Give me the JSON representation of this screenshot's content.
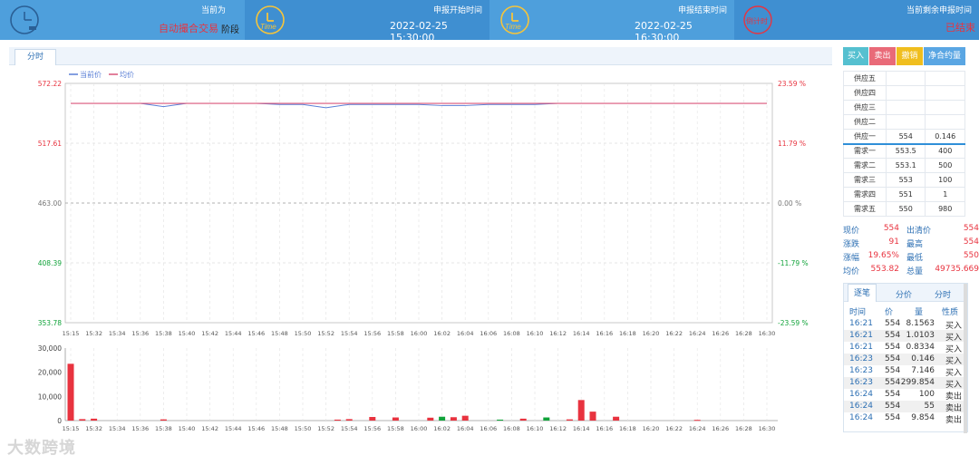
{
  "header": {
    "phase_label": "当前为",
    "phase_value": "自动撮合交易",
    "phase_suffix": "阶段",
    "start_label": "申报开始时间",
    "start_value": "2022-02-25 15:30:00",
    "end_label": "申报结束时间",
    "end_value": "2022-02-25 16:30:00",
    "countdown_icon_text": "倒计时",
    "remaining_label": "当前剩余申报时间",
    "remaining_value": "已结束",
    "time_icon_text": "Time"
  },
  "tabs": {
    "minute": "分时"
  },
  "buttons": {
    "buy": "买入",
    "sell": "卖出",
    "cancel": "撤销",
    "net": "净合约量"
  },
  "colors": {
    "buy": "#55c0d0",
    "sell": "#e96a78",
    "cancel": "#f0be1e",
    "net": "#5aa6e3",
    "up": "#e8333f",
    "down": "#11a33a",
    "header": "#4e9fdc"
  },
  "order_book": {
    "asks": [
      {
        "label": "供应五",
        "price": "",
        "qty": ""
      },
      {
        "label": "供应四",
        "price": "",
        "qty": ""
      },
      {
        "label": "供应三",
        "price": "",
        "qty": ""
      },
      {
        "label": "供应二",
        "price": "",
        "qty": ""
      },
      {
        "label": "供应一",
        "price": "554",
        "qty": "0.146"
      }
    ],
    "bids": [
      {
        "label": "需求一",
        "price": "553.5",
        "qty": "400"
      },
      {
        "label": "需求二",
        "price": "553.1",
        "qty": "500"
      },
      {
        "label": "需求三",
        "price": "553",
        "qty": "100"
      },
      {
        "label": "需求四",
        "price": "551",
        "qty": "1"
      },
      {
        "label": "需求五",
        "price": "550",
        "qty": "980"
      }
    ]
  },
  "quote": {
    "rows": [
      {
        "l1": "现价",
        "v1": "554",
        "l2": "出清价",
        "v2": "554"
      },
      {
        "l1": "涨跌",
        "v1": "91",
        "l2": "最高",
        "v2": "554"
      },
      {
        "l1": "涨幅",
        "v1": "19.65%",
        "l2": "最低",
        "v2": "550"
      },
      {
        "l1": "均价",
        "v1": "553.82",
        "l2": "总量",
        "v2": "49735.669"
      }
    ]
  },
  "ticks": {
    "tabs": [
      "逐笔",
      "分价",
      "分时"
    ],
    "headers": [
      "时间",
      "价",
      "量",
      "性质"
    ],
    "rows": [
      {
        "time": "16:21",
        "price": "554",
        "qty": "8.1563",
        "side": "买入"
      },
      {
        "time": "16:21",
        "price": "554",
        "qty": "1.0103",
        "side": "买入"
      },
      {
        "time": "16:21",
        "price": "554",
        "qty": "0.8334",
        "side": "买入"
      },
      {
        "time": "16:23",
        "price": "554",
        "qty": "0.146",
        "side": "买入"
      },
      {
        "time": "16:23",
        "price": "554",
        "qty": "7.146",
        "side": "买入"
      },
      {
        "time": "16:23",
        "price": "554",
        "qty": "299.854",
        "side": "买入"
      },
      {
        "time": "16:24",
        "price": "554",
        "qty": "100",
        "side": "卖出"
      },
      {
        "time": "16:24",
        "price": "554",
        "qty": "55",
        "side": "卖出"
      },
      {
        "time": "16:24",
        "price": "554",
        "qty": "9.854",
        "side": "卖出"
      }
    ]
  },
  "watermark": "大数跨境",
  "chart_data": [
    {
      "type": "line",
      "legend": [
        "当前价",
        "均价"
      ],
      "y_left_ticks": [
        "572.22",
        "517.61",
        "463.00",
        "408.39",
        "353.78"
      ],
      "y_right_ticks": [
        "23.59 %",
        "11.79 %",
        "0.00 %",
        "-11.79 %",
        "-23.59 %"
      ],
      "ylim": [
        353.78,
        572.22
      ],
      "x_ticks": [
        "15:15",
        "15:32",
        "15:34",
        "15:36",
        "15:38",
        "15:40",
        "15:42",
        "15:44",
        "15:46",
        "15:48",
        "15:50",
        "15:52",
        "15:54",
        "15:56",
        "15:58",
        "16:00",
        "16:02",
        "16:04",
        "16:06",
        "16:08",
        "16:10",
        "16:12",
        "16:14",
        "16:16",
        "16:18",
        "16:20",
        "16:22",
        "16:24",
        "16:26",
        "16:28",
        "16:30"
      ],
      "series": [
        {
          "name": "当前价",
          "color": "#5a7fd6",
          "values": [
            554,
            554,
            554,
            554,
            551,
            554,
            554,
            554,
            554,
            553,
            553,
            550,
            553,
            553,
            553,
            553,
            552,
            552,
            553,
            553,
            553,
            554,
            554,
            554,
            554,
            554,
            554,
            554,
            554,
            554,
            554
          ]
        },
        {
          "name": "均价",
          "color": "#d9567a",
          "values": [
            554,
            554,
            554,
            554,
            554,
            554,
            554,
            554,
            554,
            554,
            554,
            554,
            554,
            554,
            554,
            554,
            554,
            554,
            554,
            554,
            554,
            554,
            554,
            554,
            554,
            554,
            554,
            554,
            554,
            554,
            554
          ]
        }
      ]
    },
    {
      "type": "bar",
      "y_ticks": [
        "30,000",
        "20,000",
        "10,000",
        "0"
      ],
      "ylim": [
        0,
        30000
      ],
      "bars": [
        {
          "x": "15:15",
          "value": 23500,
          "color": "red"
        },
        {
          "x": "15:31",
          "value": 600,
          "color": "red"
        },
        {
          "x": "15:32",
          "value": 800,
          "color": "red"
        },
        {
          "x": "15:38",
          "value": 500,
          "color": "red"
        },
        {
          "x": "15:53",
          "value": 400,
          "color": "red"
        },
        {
          "x": "15:54",
          "value": 600,
          "color": "red"
        },
        {
          "x": "15:56",
          "value": 1500,
          "color": "red"
        },
        {
          "x": "15:58",
          "value": 1300,
          "color": "red"
        },
        {
          "x": "16:01",
          "value": 1200,
          "color": "red"
        },
        {
          "x": "16:02",
          "value": 1600,
          "color": "green"
        },
        {
          "x": "16:03",
          "value": 1400,
          "color": "red"
        },
        {
          "x": "16:04",
          "value": 2000,
          "color": "red"
        },
        {
          "x": "16:07",
          "value": 400,
          "color": "green"
        },
        {
          "x": "16:09",
          "value": 800,
          "color": "red"
        },
        {
          "x": "16:11",
          "value": 1300,
          "color": "green"
        },
        {
          "x": "16:13",
          "value": 500,
          "color": "red"
        },
        {
          "x": "16:14",
          "value": 8500,
          "color": "red"
        },
        {
          "x": "16:15",
          "value": 3700,
          "color": "red"
        },
        {
          "x": "16:17",
          "value": 1600,
          "color": "red"
        },
        {
          "x": "16:24",
          "value": 300,
          "color": "red"
        }
      ]
    }
  ]
}
